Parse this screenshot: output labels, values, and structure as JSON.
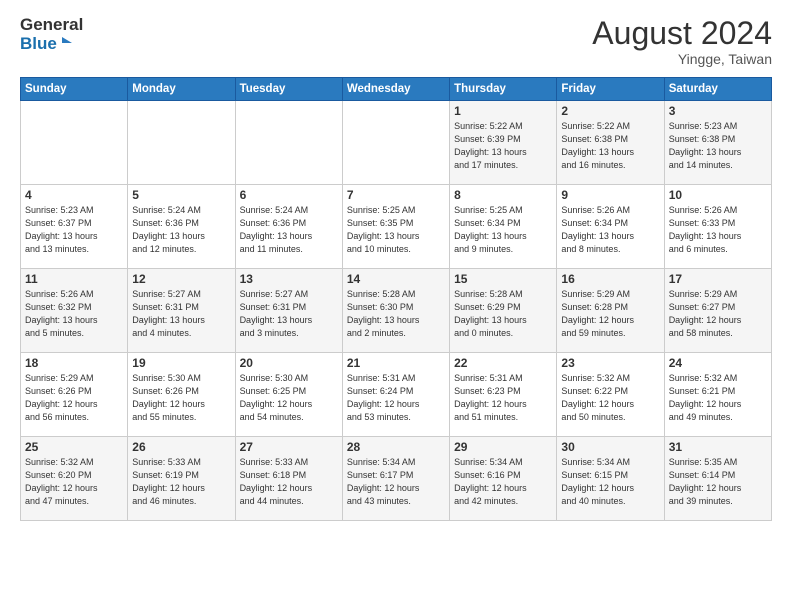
{
  "logo": {
    "line1": "General",
    "line2": "Blue"
  },
  "title": "August 2024",
  "location": "Yingge, Taiwan",
  "days_header": [
    "Sunday",
    "Monday",
    "Tuesday",
    "Wednesday",
    "Thursday",
    "Friday",
    "Saturday"
  ],
  "weeks": [
    [
      {
        "day": "",
        "info": ""
      },
      {
        "day": "",
        "info": ""
      },
      {
        "day": "",
        "info": ""
      },
      {
        "day": "",
        "info": ""
      },
      {
        "day": "1",
        "info": "Sunrise: 5:22 AM\nSunset: 6:39 PM\nDaylight: 13 hours\nand 17 minutes."
      },
      {
        "day": "2",
        "info": "Sunrise: 5:22 AM\nSunset: 6:38 PM\nDaylight: 13 hours\nand 16 minutes."
      },
      {
        "day": "3",
        "info": "Sunrise: 5:23 AM\nSunset: 6:38 PM\nDaylight: 13 hours\nand 14 minutes."
      }
    ],
    [
      {
        "day": "4",
        "info": "Sunrise: 5:23 AM\nSunset: 6:37 PM\nDaylight: 13 hours\nand 13 minutes."
      },
      {
        "day": "5",
        "info": "Sunrise: 5:24 AM\nSunset: 6:36 PM\nDaylight: 13 hours\nand 12 minutes."
      },
      {
        "day": "6",
        "info": "Sunrise: 5:24 AM\nSunset: 6:36 PM\nDaylight: 13 hours\nand 11 minutes."
      },
      {
        "day": "7",
        "info": "Sunrise: 5:25 AM\nSunset: 6:35 PM\nDaylight: 13 hours\nand 10 minutes."
      },
      {
        "day": "8",
        "info": "Sunrise: 5:25 AM\nSunset: 6:34 PM\nDaylight: 13 hours\nand 9 minutes."
      },
      {
        "day": "9",
        "info": "Sunrise: 5:26 AM\nSunset: 6:34 PM\nDaylight: 13 hours\nand 8 minutes."
      },
      {
        "day": "10",
        "info": "Sunrise: 5:26 AM\nSunset: 6:33 PM\nDaylight: 13 hours\nand 6 minutes."
      }
    ],
    [
      {
        "day": "11",
        "info": "Sunrise: 5:26 AM\nSunset: 6:32 PM\nDaylight: 13 hours\nand 5 minutes."
      },
      {
        "day": "12",
        "info": "Sunrise: 5:27 AM\nSunset: 6:31 PM\nDaylight: 13 hours\nand 4 minutes."
      },
      {
        "day": "13",
        "info": "Sunrise: 5:27 AM\nSunset: 6:31 PM\nDaylight: 13 hours\nand 3 minutes."
      },
      {
        "day": "14",
        "info": "Sunrise: 5:28 AM\nSunset: 6:30 PM\nDaylight: 13 hours\nand 2 minutes."
      },
      {
        "day": "15",
        "info": "Sunrise: 5:28 AM\nSunset: 6:29 PM\nDaylight: 13 hours\nand 0 minutes."
      },
      {
        "day": "16",
        "info": "Sunrise: 5:29 AM\nSunset: 6:28 PM\nDaylight: 12 hours\nand 59 minutes."
      },
      {
        "day": "17",
        "info": "Sunrise: 5:29 AM\nSunset: 6:27 PM\nDaylight: 12 hours\nand 58 minutes."
      }
    ],
    [
      {
        "day": "18",
        "info": "Sunrise: 5:29 AM\nSunset: 6:26 PM\nDaylight: 12 hours\nand 56 minutes."
      },
      {
        "day": "19",
        "info": "Sunrise: 5:30 AM\nSunset: 6:26 PM\nDaylight: 12 hours\nand 55 minutes."
      },
      {
        "day": "20",
        "info": "Sunrise: 5:30 AM\nSunset: 6:25 PM\nDaylight: 12 hours\nand 54 minutes."
      },
      {
        "day": "21",
        "info": "Sunrise: 5:31 AM\nSunset: 6:24 PM\nDaylight: 12 hours\nand 53 minutes."
      },
      {
        "day": "22",
        "info": "Sunrise: 5:31 AM\nSunset: 6:23 PM\nDaylight: 12 hours\nand 51 minutes."
      },
      {
        "day": "23",
        "info": "Sunrise: 5:32 AM\nSunset: 6:22 PM\nDaylight: 12 hours\nand 50 minutes."
      },
      {
        "day": "24",
        "info": "Sunrise: 5:32 AM\nSunset: 6:21 PM\nDaylight: 12 hours\nand 49 minutes."
      }
    ],
    [
      {
        "day": "25",
        "info": "Sunrise: 5:32 AM\nSunset: 6:20 PM\nDaylight: 12 hours\nand 47 minutes."
      },
      {
        "day": "26",
        "info": "Sunrise: 5:33 AM\nSunset: 6:19 PM\nDaylight: 12 hours\nand 46 minutes."
      },
      {
        "day": "27",
        "info": "Sunrise: 5:33 AM\nSunset: 6:18 PM\nDaylight: 12 hours\nand 44 minutes."
      },
      {
        "day": "28",
        "info": "Sunrise: 5:34 AM\nSunset: 6:17 PM\nDaylight: 12 hours\nand 43 minutes."
      },
      {
        "day": "29",
        "info": "Sunrise: 5:34 AM\nSunset: 6:16 PM\nDaylight: 12 hours\nand 42 minutes."
      },
      {
        "day": "30",
        "info": "Sunrise: 5:34 AM\nSunset: 6:15 PM\nDaylight: 12 hours\nand 40 minutes."
      },
      {
        "day": "31",
        "info": "Sunrise: 5:35 AM\nSunset: 6:14 PM\nDaylight: 12 hours\nand 39 minutes."
      }
    ]
  ]
}
